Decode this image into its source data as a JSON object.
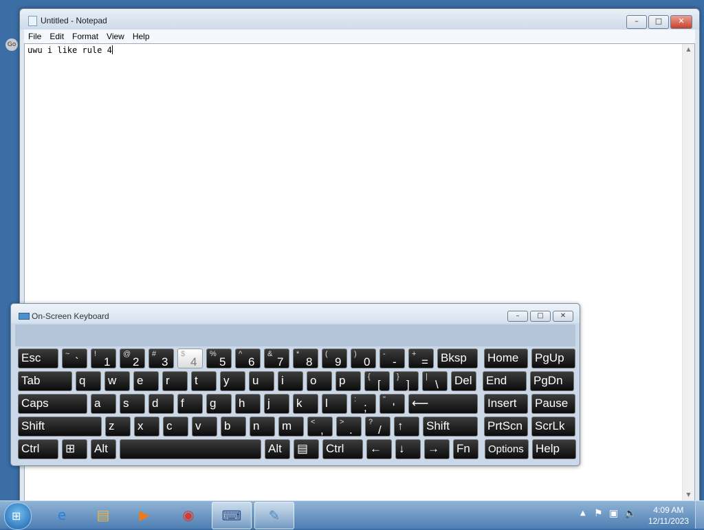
{
  "notepad": {
    "title": "Untitled - Notepad",
    "menu": [
      "File",
      "Edit",
      "Format",
      "View",
      "Help"
    ],
    "content": "uwu i like rule 4",
    "window_buttons": {
      "minimize": "–",
      "maximize": "□",
      "close": "✕"
    }
  },
  "osk": {
    "title": "On-Screen Keyboard",
    "rows": [
      [
        {
          "main": "Esc"
        },
        {
          "sub": "~",
          "main": "`"
        },
        {
          "sub": "!",
          "main": "1"
        },
        {
          "sub": "@",
          "main": "2"
        },
        {
          "sub": "#",
          "main": "3"
        },
        {
          "sub": "$",
          "main": "4",
          "pressed": true
        },
        {
          "sub": "%",
          "main": "5"
        },
        {
          "sub": "^",
          "main": "6"
        },
        {
          "sub": "&",
          "main": "7"
        },
        {
          "sub": "*",
          "main": "8"
        },
        {
          "sub": "(",
          "main": "9"
        },
        {
          "sub": ")",
          "main": "0"
        },
        {
          "sub": "-",
          "main": "-"
        },
        {
          "sub": "+",
          "main": "="
        },
        {
          "main": "Bksp"
        },
        {
          "main": "Home"
        },
        {
          "main": "PgUp"
        }
      ],
      [
        {
          "main": "Tab"
        },
        {
          "main": "q"
        },
        {
          "main": "w"
        },
        {
          "main": "e"
        },
        {
          "main": "r"
        },
        {
          "main": "t"
        },
        {
          "main": "y"
        },
        {
          "main": "u"
        },
        {
          "main": "i"
        },
        {
          "main": "o"
        },
        {
          "main": "p"
        },
        {
          "sub": "{",
          "main": "["
        },
        {
          "sub": "}",
          "main": "]"
        },
        {
          "sub": "|",
          "main": "\\"
        },
        {
          "main": "Del"
        },
        {
          "main": "End"
        },
        {
          "main": "PgDn"
        }
      ],
      [
        {
          "main": "Caps"
        },
        {
          "main": "a"
        },
        {
          "main": "s"
        },
        {
          "main": "d"
        },
        {
          "main": "f"
        },
        {
          "main": "g"
        },
        {
          "main": "h"
        },
        {
          "main": "j"
        },
        {
          "main": "k"
        },
        {
          "main": "l"
        },
        {
          "sub": ":",
          "main": ";"
        },
        {
          "sub": "\"",
          "main": "'"
        },
        {
          "main": "⟵"
        },
        {
          "main": "Insert"
        },
        {
          "main": "Pause"
        }
      ],
      [
        {
          "main": "Shift"
        },
        {
          "main": "z"
        },
        {
          "main": "x"
        },
        {
          "main": "c"
        },
        {
          "main": "v"
        },
        {
          "main": "b"
        },
        {
          "main": "n"
        },
        {
          "main": "m"
        },
        {
          "sub": "<",
          "main": ","
        },
        {
          "sub": ">",
          "main": "."
        },
        {
          "sub": "?",
          "main": "/"
        },
        {
          "main": "↑"
        },
        {
          "main": "Shift"
        },
        {
          "main": "PrtScn"
        },
        {
          "main": "ScrLk"
        }
      ],
      [
        {
          "main": "Ctrl"
        },
        {
          "main": "⊞"
        },
        {
          "main": "Alt"
        },
        {
          "main": ""
        },
        {
          "main": "Alt"
        },
        {
          "main": "▤"
        },
        {
          "main": "Ctrl"
        },
        {
          "main": "←"
        },
        {
          "main": "↓"
        },
        {
          "main": "→"
        },
        {
          "main": "Fn"
        },
        {
          "main": "Options"
        },
        {
          "main": "Help"
        }
      ]
    ]
  },
  "taskbar": {
    "start_icon": "windows-orb-icon",
    "apps": [
      {
        "name": "internet-explorer-icon",
        "glyph": "e",
        "color": "#2a7fd4"
      },
      {
        "name": "file-explorer-icon",
        "glyph": "▤",
        "color": "#e8b64a"
      },
      {
        "name": "media-player-icon",
        "glyph": "▶",
        "color": "#e97a1f"
      },
      {
        "name": "chrome-icon",
        "glyph": "◉",
        "color": "#d93a2f"
      },
      {
        "name": "on-screen-keyboard-icon",
        "glyph": "⌨",
        "color": "#2d4f86"
      },
      {
        "name": "notepad-icon",
        "glyph": "✎",
        "color": "#4d8bbf"
      }
    ],
    "time": "4:09 AM",
    "date": "12/11/2023"
  }
}
